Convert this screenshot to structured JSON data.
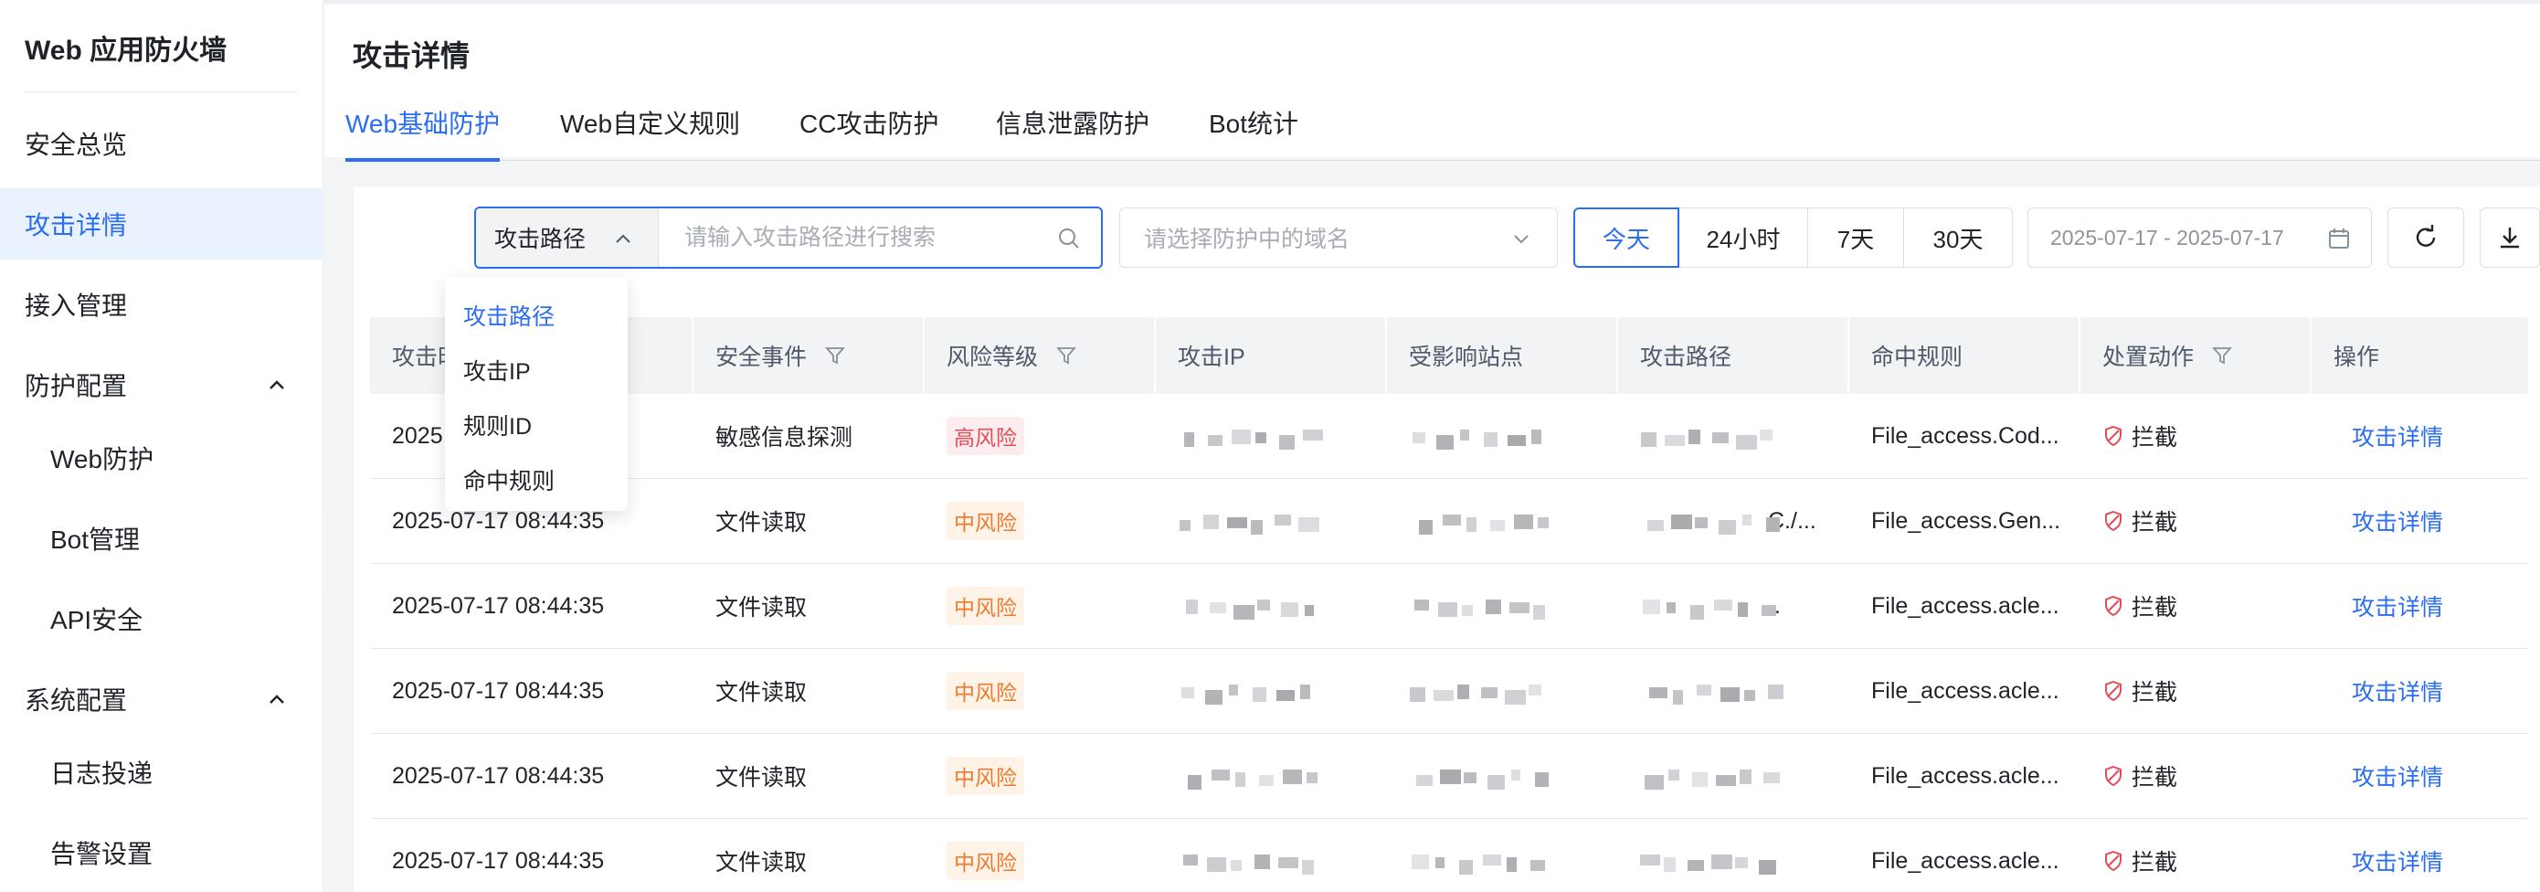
{
  "sidebar": {
    "title": "Web 应用防火墙",
    "items": [
      {
        "label": "安全总览"
      },
      {
        "label": "攻击详情"
      },
      {
        "label": "接入管理"
      },
      {
        "label": "防护配置"
      },
      {
        "label": "Web防护"
      },
      {
        "label": "Bot管理"
      },
      {
        "label": "API安全"
      },
      {
        "label": "系统配置"
      },
      {
        "label": "日志投递"
      },
      {
        "label": "告警设置"
      }
    ]
  },
  "page": {
    "title": "攻击详情",
    "tabs": [
      {
        "label": "Web基础防护"
      },
      {
        "label": "Web自定义规则"
      },
      {
        "label": "CC攻击防护"
      },
      {
        "label": "信息泄露防护"
      },
      {
        "label": "Bot统计"
      }
    ]
  },
  "filters": {
    "search_field": "攻击路径",
    "search_placeholder": "请输入攻击路径进行搜索",
    "domain_placeholder": "请选择防护中的域名",
    "ranges": [
      {
        "label": "今天"
      },
      {
        "label": "24小时"
      },
      {
        "label": "7天"
      },
      {
        "label": "30天"
      }
    ],
    "date_range": "2025-07-17 - 2025-07-17"
  },
  "dropdown": {
    "options": [
      {
        "label": "攻击路径"
      },
      {
        "label": "攻击IP"
      },
      {
        "label": "规则ID"
      },
      {
        "label": "命中规则"
      }
    ]
  },
  "table": {
    "columns": [
      {
        "label": "攻击时间"
      },
      {
        "label": "安全事件"
      },
      {
        "label": "风险等级"
      },
      {
        "label": "攻击IP"
      },
      {
        "label": "受影响站点"
      },
      {
        "label": "攻击路径"
      },
      {
        "label": "命中规则"
      },
      {
        "label": "处置动作"
      },
      {
        "label": "操作"
      }
    ],
    "rows": [
      {
        "time": "2025",
        "event": "敏感信息探测",
        "risk": "高风险",
        "path_suffix": "",
        "rule": "File_access.Cod...",
        "action": "拦截",
        "op": "攻击详情"
      },
      {
        "time": "2025-07-17 08:44:35",
        "event": "文件读取",
        "risk": "中风险",
        "path_suffix": "C./...",
        "rule": "File_access.Gen...",
        "action": "拦截",
        "op": "攻击详情"
      },
      {
        "time": "2025-07-17 08:44:35",
        "event": "文件读取",
        "risk": "中风险",
        "path_suffix": "..",
        "rule": "File_access.acle...",
        "action": "拦截",
        "op": "攻击详情"
      },
      {
        "time": "2025-07-17 08:44:35",
        "event": "文件读取",
        "risk": "中风险",
        "path_suffix": ".",
        "rule": "File_access.acle...",
        "action": "拦截",
        "op": "攻击详情"
      },
      {
        "time": "2025-07-17 08:44:35",
        "event": "文件读取",
        "risk": "中风险",
        "path_suffix": "",
        "rule": "File_access.acle...",
        "action": "拦截",
        "op": "攻击详情"
      },
      {
        "time": "2025-07-17 08:44:35",
        "event": "文件读取",
        "risk": "中风险",
        "path_suffix": "",
        "rule": "File_access.acle...",
        "action": "拦截",
        "op": "攻击详情"
      }
    ]
  },
  "colors": {
    "accent": "#2b6ef2",
    "high_risk": "#e34d59",
    "mid_risk": "#ed7b2f",
    "blocked": "#e34d59"
  }
}
